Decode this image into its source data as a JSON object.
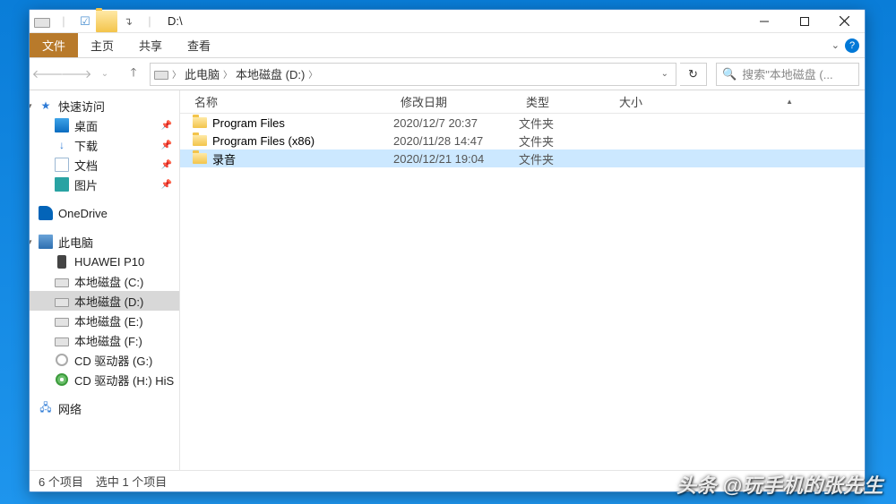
{
  "titlebar": {
    "title": "D:\\"
  },
  "ribbon": {
    "file": "文件",
    "tabs": [
      "主页",
      "共享",
      "查看"
    ]
  },
  "breadcrumb": {
    "root": "此电脑",
    "drive": "本地磁盘 (D:)"
  },
  "search": {
    "placeholder": "搜索\"本地磁盘 (..."
  },
  "columns": {
    "name": "名称",
    "date": "修改日期",
    "type": "类型",
    "size": "大小"
  },
  "nav": {
    "quick": {
      "label": "快速访问",
      "items": [
        {
          "label": "桌面",
          "icon": "desktop"
        },
        {
          "label": "下载",
          "icon": "down"
        },
        {
          "label": "文档",
          "icon": "doc"
        },
        {
          "label": "图片",
          "icon": "pic"
        }
      ]
    },
    "onedrive": {
      "label": "OneDrive"
    },
    "pc": {
      "label": "此电脑",
      "items": [
        {
          "label": "HUAWEI P10",
          "icon": "phone"
        },
        {
          "label": "本地磁盘 (C:)",
          "icon": "drive"
        },
        {
          "label": "本地磁盘 (D:)",
          "icon": "drive",
          "selected": true
        },
        {
          "label": "本地磁盘 (E:)",
          "icon": "drive"
        },
        {
          "label": "本地磁盘 (F:)",
          "icon": "drive"
        },
        {
          "label": "CD 驱动器 (G:)",
          "icon": "cd"
        },
        {
          "label": "CD 驱动器 (H:) HiS",
          "icon": "cdg"
        }
      ]
    },
    "network": {
      "label": "网络"
    }
  },
  "files": [
    {
      "name": "Program Files",
      "date": "2020/12/7 20:37",
      "type": "文件夹"
    },
    {
      "name": "Program Files (x86)",
      "date": "2020/11/28 14:47",
      "type": "文件夹"
    },
    {
      "name": "录音",
      "date": "2020/12/21 19:04",
      "type": "文件夹",
      "selected": true
    }
  ],
  "status": {
    "count": "6 个项目",
    "selected": "选中 1 个项目"
  },
  "watermark": "头条 @玩手机的张先生"
}
